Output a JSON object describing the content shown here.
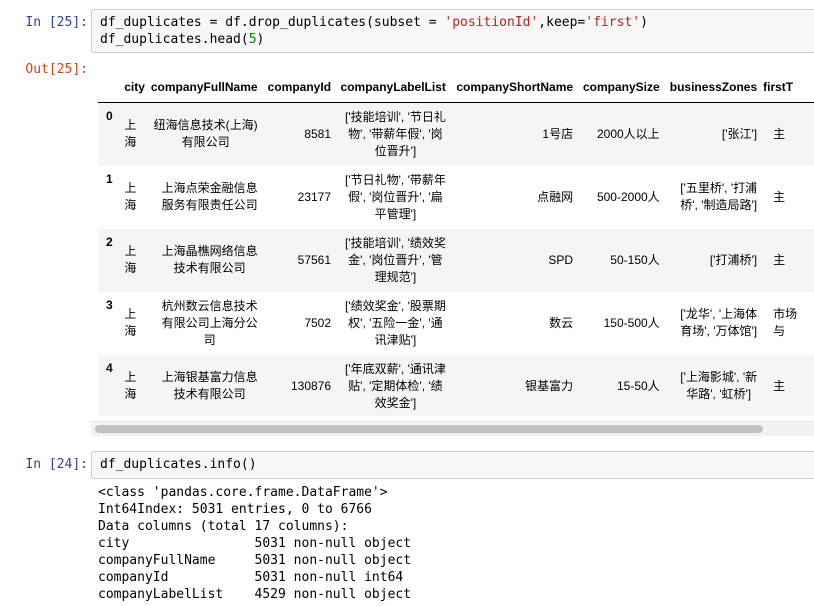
{
  "cell25": {
    "in_prompt": "In [25]:",
    "out_prompt": "Out[25]:",
    "code_line1_a": "df_duplicates = df.drop_duplicates(subset = ",
    "code_line1_str1": "'positionId'",
    "code_line1_b": ",keep=",
    "code_line1_str2": "'first'",
    "code_line1_c": ")",
    "code_line2_a": "df_duplicates.head(",
    "code_line2_num": "5",
    "code_line2_b": ")"
  },
  "table": {
    "columns": [
      "",
      "city",
      "companyFullName",
      "companyId",
      "companyLabelList",
      "companyShortName",
      "companySize",
      "businessZones",
      "firstT"
    ],
    "rows": [
      {
        "index": "0",
        "city": [
          "上",
          "海"
        ],
        "companyFullName": [
          "纽海信息技术(上海)",
          "有限公司"
        ],
        "companyId": "8581",
        "companyLabelList": [
          "['技能培训', '节日礼",
          "物', '带薪年假', '岗",
          "位晋升']"
        ],
        "companyShortName": "1号店",
        "companySize": "2000人以上",
        "businessZones": [
          "['张江']"
        ],
        "firstT": "主"
      },
      {
        "index": "1",
        "city": [
          "上",
          "海"
        ],
        "companyFullName": [
          "上海点荣金融信息",
          "服务有限责任公司"
        ],
        "companyId": "23177",
        "companyLabelList": [
          "['节日礼物', '带薪年",
          "假', '岗位晋升', '扁",
          "平管理']"
        ],
        "companyShortName": "点融网",
        "companySize": "500-2000人",
        "businessZones": [
          "['五里桥', '打浦",
          "桥', '制造局路']"
        ],
        "firstT": "主"
      },
      {
        "index": "2",
        "city": [
          "上",
          "海"
        ],
        "companyFullName": [
          "上海晶樵网络信息",
          "技术有限公司"
        ],
        "companyId": "57561",
        "companyLabelList": [
          "['技能培训', '绩效奖",
          "金', '岗位晋升', '管",
          "理规范']"
        ],
        "companyShortName": "SPD",
        "companySize": "50-150人",
        "businessZones": [
          "['打浦桥']"
        ],
        "firstT": "主"
      },
      {
        "index": "3",
        "city": [
          "上",
          "海"
        ],
        "companyFullName": [
          "杭州数云信息技术",
          "有限公司上海分公",
          "司"
        ],
        "companyId": "7502",
        "companyLabelList": [
          "['绩效奖金', '股票期",
          "权', '五险一金', '通",
          "讯津贴']"
        ],
        "companyShortName": "数云",
        "companySize": "150-500人",
        "businessZones": [
          "['龙华', '上海体",
          "育场', '万体馆']"
        ],
        "firstT": "市场与"
      },
      {
        "index": "4",
        "city": [
          "上",
          "海"
        ],
        "companyFullName": [
          "上海银基富力信息",
          "技术有限公司"
        ],
        "companyId": "130876",
        "companyLabelList": [
          "['年底双薪', '通讯津",
          "贴', '定期体检', '绩",
          "效奖金']"
        ],
        "companyShortName": "银基富力",
        "companySize": "15-50人",
        "businessZones": [
          "['上海影城', '新",
          "华路', '虹桥']"
        ],
        "firstT": "主"
      }
    ]
  },
  "cell24": {
    "in_prompt": "In [24]:",
    "code": "df_duplicates.info()",
    "output_lines": [
      "<class 'pandas.core.frame.DataFrame'>",
      "Int64Index: 5031 entries, 0 to 6766",
      "Data columns (total 17 columns):",
      "city                5031 non-null object",
      "companyFullName     5031 non-null object",
      "companyId           5031 non-null int64",
      "companyLabelList    4529 non-null object"
    ]
  },
  "colors": {
    "in_prompt": "#303f9f",
    "out_prompt": "#d84315",
    "string": "#ba2121",
    "number": "#008000",
    "code_bg": "#f7f7f7"
  }
}
